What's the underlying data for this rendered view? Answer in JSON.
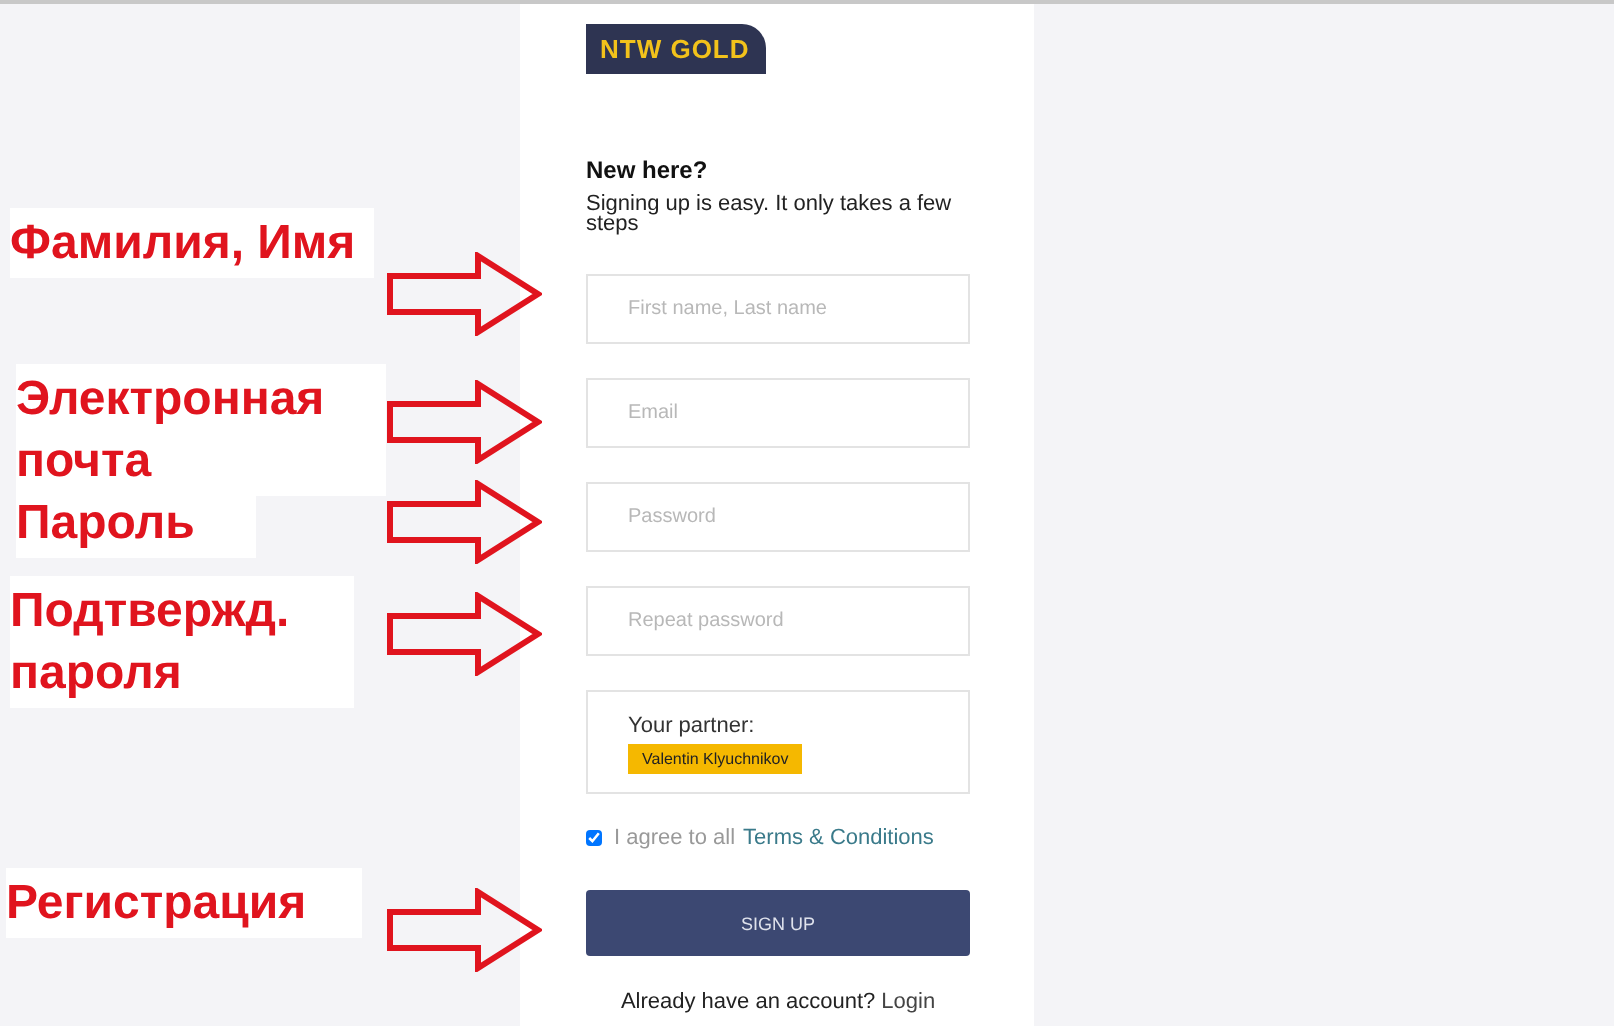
{
  "logo": "NTW GOLD",
  "heading": "New here?",
  "subheading": "Signing up is easy. It only takes a few steps",
  "fields": [
    {
      "placeholder": "First name, Last name"
    },
    {
      "placeholder": "Email"
    },
    {
      "placeholder": "Password"
    },
    {
      "placeholder": "Repeat password"
    }
  ],
  "partner": {
    "label": "Your partner:",
    "name": "Valentin Klyuchnikov"
  },
  "agree": {
    "checked": true,
    "text": "I agree to all",
    "link": "Terms & Conditions"
  },
  "submit": "SIGN UP",
  "login": {
    "text": "Already have an account?",
    "link": "Login"
  },
  "annotations": [
    {
      "label": "Фамилия, Имя"
    },
    {
      "label": "Электронная почта"
    },
    {
      "label": "Пароль"
    },
    {
      "label": "Подтвержд. пароля"
    },
    {
      "label": "Регистрация"
    }
  ]
}
